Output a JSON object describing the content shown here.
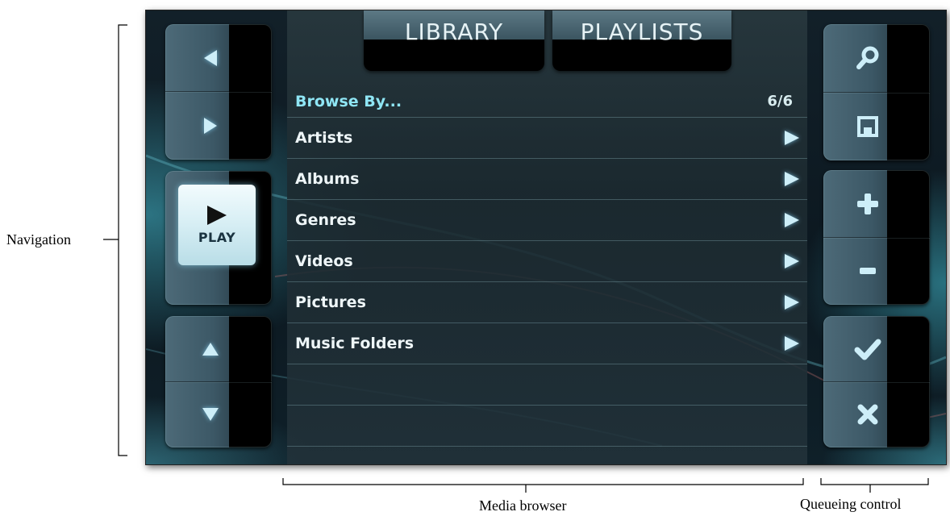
{
  "tabs": [
    {
      "label": "LIBRARY"
    },
    {
      "label": "PLAYLISTS"
    }
  ],
  "browser": {
    "title": "Browse By...",
    "count": "6/6",
    "items": [
      {
        "label": "Artists"
      },
      {
        "label": "Albums"
      },
      {
        "label": "Genres"
      },
      {
        "label": "Videos"
      },
      {
        "label": "Pictures"
      },
      {
        "label": "Music Folders"
      }
    ]
  },
  "navigation": {
    "play_label": "PLAY"
  },
  "annotations": {
    "navigation": "Navigation",
    "media_browser": "Media browser",
    "queueing_control": "Queueing control"
  },
  "icons": {
    "nav_left": "left-arrow-icon",
    "nav_right": "right-arrow-icon",
    "play": "play-icon",
    "nav_up": "up-arrow-icon",
    "nav_down": "down-arrow-icon",
    "search": "search-icon",
    "save": "save-icon",
    "add": "plus-icon",
    "remove": "minus-icon",
    "confirm": "check-icon",
    "cancel": "close-icon",
    "item_arrow": "chevron-right-icon"
  },
  "colors": {
    "accent": "#8fe6f5",
    "glyph": "#c9f0fb",
    "panel": "#1c2a30"
  }
}
